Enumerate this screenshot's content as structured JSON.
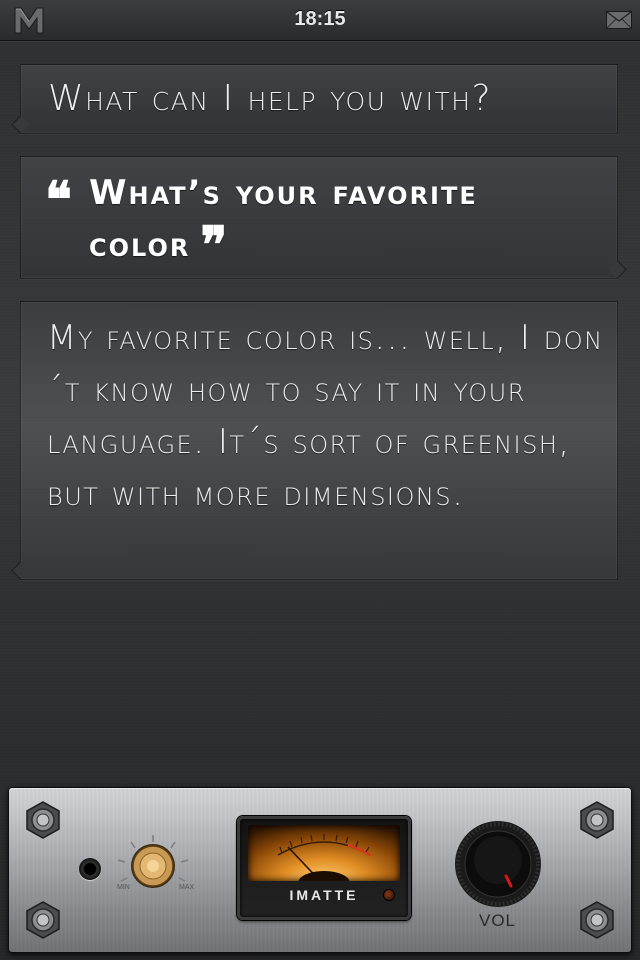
{
  "status_bar": {
    "time": "18:15",
    "logo_icon": "m-logo-icon",
    "mail_icon": "mail-icon"
  },
  "conversation": {
    "assistant_prompt": "What can I help you with?",
    "user_query": "What’s your favorite color",
    "open_quote": "❝",
    "close_quote": "❞",
    "assistant_reply": "My favorite color is... well, I don´t know how to say it in your language. It´s sort of greenish, but with more dimensions."
  },
  "amp_panel": {
    "gain_min_label": "MIN",
    "gain_max_label": "MAX",
    "meter_brand": "IMATTE",
    "volume_label": "VOL",
    "colors": {
      "meter_glow": "#e28f24",
      "meter_red_zone": "#d23a1a"
    }
  }
}
